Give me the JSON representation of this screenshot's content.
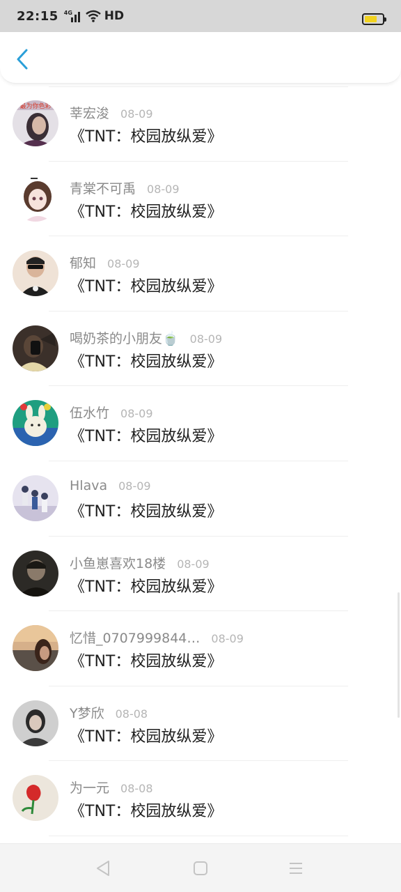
{
  "status_bar": {
    "time": "22:15",
    "network": "4G",
    "hd": "HD",
    "battery_color": "#f2d31f"
  },
  "header": {
    "back_icon": "chevron-left-icon",
    "accent": "#2a9fd8"
  },
  "list": [
    {
      "name": "莘宏浚",
      "date": "08-09",
      "title": "《TNT：校园放纵爱》",
      "avatar": "avatar-1"
    },
    {
      "name": "青棠不可禹",
      "date": "08-09",
      "title": "《TNT：校园放纵爱》",
      "avatar": "avatar-2"
    },
    {
      "name": "郁知",
      "date": "08-09",
      "title": "《TNT：校园放纵爱》",
      "avatar": "avatar-3"
    },
    {
      "name": "喝奶茶的小朋友🍵",
      "date": "08-09",
      "title": "《TNT：校园放纵爱》",
      "avatar": "avatar-4"
    },
    {
      "name": "伍水竹",
      "date": "08-09",
      "title": "《TNT：校园放纵爱》",
      "avatar": "avatar-5"
    },
    {
      "name": "Hlava",
      "date": "08-09",
      "title": "《TNT：校园放纵爱》",
      "avatar": "avatar-6"
    },
    {
      "name": "小鱼崽喜欢18楼",
      "date": "08-09",
      "title": "《TNT：校园放纵爱》",
      "avatar": "avatar-7"
    },
    {
      "name": "忆惜_0707999844…",
      "date": "08-09",
      "title": "《TNT：校园放纵爱》",
      "avatar": "avatar-8"
    },
    {
      "name": "Y梦欣",
      "date": "08-08",
      "title": "《TNT：校园放纵爱》",
      "avatar": "avatar-9"
    },
    {
      "name": "为一元",
      "date": "08-08",
      "title": "《TNT：校园放纵爱》",
      "avatar": "avatar-10"
    }
  ],
  "nav_bar": {
    "back": "triangle-back-icon",
    "home": "square-home-icon",
    "menu": "menu-lines-icon"
  }
}
